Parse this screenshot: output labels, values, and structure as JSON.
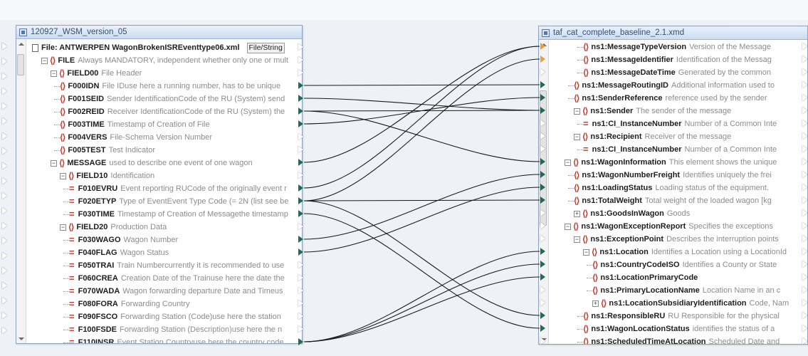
{
  "left_panel": {
    "title": "120927_WSM_version_05",
    "rows": [
      {
        "kind": "file",
        "name": "File: ANTWERPEN WagonBrokenISREventtype06.xml",
        "desc": "",
        "tab": "File/String",
        "level": 0
      },
      {
        "kind": "elem",
        "name": "FILE",
        "desc": "Always MANDATORY, independent whether only one or mult",
        "level": 1,
        "exp": "-"
      },
      {
        "kind": "elem",
        "name": "FIELD00",
        "desc": "File Header",
        "level": 2,
        "exp": "-"
      },
      {
        "kind": "elem",
        "name": "F000IDN",
        "desc": "File IDuse here a running number, has to be unique",
        "level": 3
      },
      {
        "kind": "elem",
        "name": "F001SEID",
        "desc": "Sender IdentificationCode of the RU (System) send",
        "level": 3
      },
      {
        "kind": "elem",
        "name": "F002REID",
        "desc": "Receiver IdentificationCode of the RU (System) the",
        "level": 3
      },
      {
        "kind": "elem",
        "name": "F003TIME",
        "desc": "Timestamp of Creation of File",
        "level": 3
      },
      {
        "kind": "elem",
        "name": "F004VERS",
        "desc": "File-Schema Version Number",
        "level": 3
      },
      {
        "kind": "elem",
        "name": "F005TEST",
        "desc": "Test Indicator",
        "level": 3
      },
      {
        "kind": "elem",
        "name": "MESSAGE",
        "desc": "used to describe one event of one wagon",
        "level": 2,
        "exp": "-"
      },
      {
        "kind": "elem",
        "name": "FIELD10",
        "desc": "Identification",
        "level": 3,
        "exp": "-"
      },
      {
        "kind": "attr",
        "name": "F010EVRU",
        "desc": "Event reporting RUCode of the originally event r",
        "level": 4
      },
      {
        "kind": "attr",
        "name": "F020ETYP",
        "desc": "Type of EventEvent Type Code (= 2N (list see be",
        "level": 4
      },
      {
        "kind": "attr",
        "name": "F030TIME",
        "desc": "Timestamp of Creation of Messagethe timestamp",
        "level": 4
      },
      {
        "kind": "elem",
        "name": "FIELD20",
        "desc": "Production Data",
        "level": 3,
        "exp": "-"
      },
      {
        "kind": "attr",
        "name": "F030WAGO",
        "desc": "Wagon Number",
        "level": 4
      },
      {
        "kind": "attr",
        "name": "F040FLAG",
        "desc": "Wagon Status",
        "level": 4
      },
      {
        "kind": "attr",
        "name": "F050TRAI",
        "desc": "Train Numbercurrently it is recommended to use",
        "level": 4
      },
      {
        "kind": "attr",
        "name": "F060CREA",
        "desc": "Creation Date of the Trainuse here the date the",
        "level": 4
      },
      {
        "kind": "attr",
        "name": "F070WADA",
        "desc": "Wagon forwarding departure Date and Timeus",
        "level": 4
      },
      {
        "kind": "attr",
        "name": "F080FORA",
        "desc": "Forwarding Country",
        "level": 4
      },
      {
        "kind": "attr",
        "name": "F090FSCO",
        "desc": "Forwarding Station (Code)use here the station",
        "level": 4
      },
      {
        "kind": "attr",
        "name": "F100FSDE",
        "desc": "Forwarding Station (Description)use here the n",
        "level": 4
      },
      {
        "kind": "attr",
        "name": "F110INSR",
        "desc": "Event Station Countryuse here the country code",
        "level": 4
      }
    ]
  },
  "right_panel": {
    "title": "taf_cat_complete_baseline_2.1.xmd",
    "rows": [
      {
        "kind": "elem",
        "name": "ns1:MessageTypeVersion",
        "desc": "Version of the Message",
        "level": 3
      },
      {
        "kind": "elem",
        "name": "ns1:MessageIdentifier",
        "desc": "Identification of the Messag",
        "level": 3
      },
      {
        "kind": "elem",
        "name": "ns1:MessageDateTime",
        "desc": "Generated by the common",
        "level": 3
      },
      {
        "kind": "elem",
        "name": "ns1:MessageRoutingID",
        "desc": "Additional information used to",
        "level": 2
      },
      {
        "kind": "elem",
        "name": "ns1:SenderReference",
        "desc": "reference used by the sender",
        "level": 2
      },
      {
        "kind": "elem",
        "name": "ns1:Sender",
        "desc": "The sender of the message",
        "level": 2,
        "exp": "-"
      },
      {
        "kind": "attr",
        "name": "ns1:CI_InstanceNumber",
        "desc": "Number of a Common Inte",
        "level": 3
      },
      {
        "kind": "elem",
        "name": "ns1:Recipient",
        "desc": "Receiver of the message",
        "level": 2,
        "exp": "-"
      },
      {
        "kind": "attr",
        "name": "ns1:CI_InstanceNumber",
        "desc": "Number of a Common Inte",
        "level": 3
      },
      {
        "kind": "elem",
        "name": "ns1:WagonInformation",
        "desc": "This element shows the unique",
        "level": 1,
        "exp": "-"
      },
      {
        "kind": "elem",
        "name": "ns1:WagonNumberFreight",
        "desc": "Identifies uniquely the frei",
        "level": 2
      },
      {
        "kind": "elem",
        "name": "ns1:LoadingStatus",
        "desc": "Loading status of the equipment.",
        "level": 2
      },
      {
        "kind": "elem",
        "name": "ns1:TotalWeight",
        "desc": "Total weight of the loaded wagon [kg",
        "level": 2
      },
      {
        "kind": "elem",
        "name": "ns1:GoodsInWagon",
        "desc": "Goods",
        "level": 2,
        "exp": "+"
      },
      {
        "kind": "elem",
        "name": "ns1:WagonExceptionReport",
        "desc": "Specifies the exceptions",
        "level": 1,
        "exp": "-"
      },
      {
        "kind": "elem",
        "name": "ns1:ExceptionPoint",
        "desc": "Describes the interruption points",
        "level": 2,
        "exp": "-"
      },
      {
        "kind": "elem",
        "name": "ns1:Location",
        "desc": "Identifies a Location using a LocationId",
        "level": 3,
        "exp": "-"
      },
      {
        "kind": "elem",
        "name": "ns1:CountryCodeISO",
        "desc": "Identifies a County or State",
        "level": 4
      },
      {
        "kind": "elem",
        "name": "ns1:LocationPrimaryCode",
        "desc": "",
        "level": 4
      },
      {
        "kind": "elem",
        "name": "ns1:PrimaryLocationName",
        "desc": "Location Name in an c",
        "level": 4
      },
      {
        "kind": "elem",
        "name": "ns1:LocationSubsidiaryIdentification",
        "desc": "Code, Nam",
        "level": 4,
        "exp": "+"
      },
      {
        "kind": "elem",
        "name": "ns1:ResponsibleRU",
        "desc": "RU Responsible for the physical",
        "level": 3
      },
      {
        "kind": "elem",
        "name": "ns1:WagonLocationStatus",
        "desc": "identifies the status of a",
        "level": 3
      },
      {
        "kind": "elem",
        "name": "ns1:ScheduledTimeAtLocation",
        "desc": "Scheduled Date and",
        "level": 3
      }
    ]
  },
  "mappings": [
    {
      "from": 3,
      "to": 3
    },
    {
      "from": 4,
      "to": 5
    },
    {
      "from": 5,
      "to": 9
    },
    {
      "from": 5,
      "to": 5
    },
    {
      "from": 6,
      "to": 4
    },
    {
      "from": 9,
      "to": 0
    },
    {
      "from": 11,
      "to": 0
    },
    {
      "from": 12,
      "to": 1
    },
    {
      "from": 12,
      "to": 12
    },
    {
      "from": 12,
      "to": 21
    },
    {
      "from": 13,
      "to": 22
    },
    {
      "from": 15,
      "to": 10
    },
    {
      "from": 16,
      "to": 11
    },
    {
      "from": 23,
      "to": 16
    },
    {
      "from": 23,
      "to": 17
    },
    {
      "from": 23,
      "to": 18
    }
  ],
  "colors": {
    "wire": "#1a1a1a",
    "connector_mapped": "#1e6b5c",
    "connector_orange": "#e8a13a",
    "element_icon": "#c0392b"
  }
}
